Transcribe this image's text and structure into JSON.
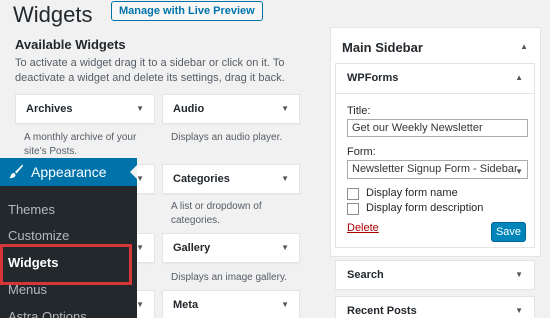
{
  "header": {
    "title": "Widgets",
    "preview_button": "Manage with Live Preview"
  },
  "available": {
    "title": "Available Widgets",
    "description": "To activate a widget drag it to a sidebar or click on it. To deactivate a widget and delete its settings, drag it back."
  },
  "widgets": [
    {
      "label": "Archives",
      "desc": "A monthly archive of your site’s Posts."
    },
    {
      "label": "Audio",
      "desc": "Displays an audio player."
    },
    {
      "label": "Categories",
      "desc": "A list or dropdown of categories."
    },
    {
      "label": "Gallery",
      "desc": "Displays an image gallery."
    },
    {
      "label": "Meta",
      "desc": ""
    }
  ],
  "admin_menu": {
    "section": "Appearance",
    "items": [
      "Themes",
      "Customize",
      "Widgets",
      "Menus",
      "Astra Options"
    ],
    "current": "Widgets"
  },
  "sidebar": {
    "title": "Main Sidebar",
    "wpforms": {
      "title": "WPForms",
      "title_label": "Title:",
      "title_value": "Get our Weekly Newsletter",
      "form_label": "Form:",
      "form_value": "Newsletter Signup Form - Sidebar",
      "checkbox_name": "Display form name",
      "checkbox_desc": "Display form description",
      "delete_label": "Delete",
      "save_label": "Save"
    },
    "search_label": "Search",
    "recent_label": "Recent Posts"
  },
  "colors": {
    "accent": "#0073aa",
    "highlight": "#d63638"
  }
}
